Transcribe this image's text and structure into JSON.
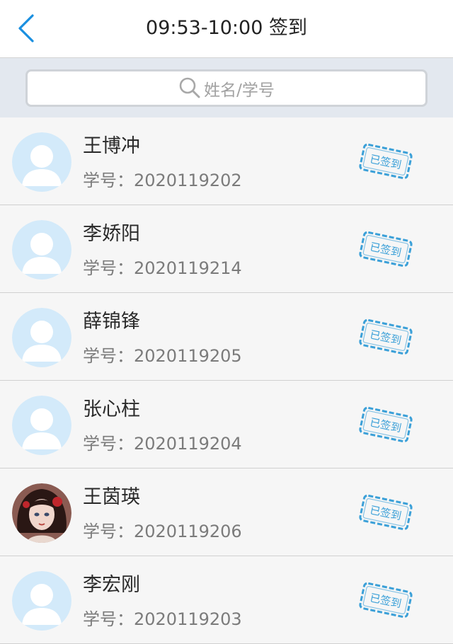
{
  "header": {
    "title": "09:53-10:00 签到"
  },
  "search": {
    "placeholder": "姓名/学号"
  },
  "students": [
    {
      "name": "王博冲",
      "id_label": "学号：2020119202",
      "status": "已签到",
      "avatar": "default"
    },
    {
      "name": "李娇阳",
      "id_label": "学号：2020119214",
      "status": "已签到",
      "avatar": "default"
    },
    {
      "name": "薛锦锋",
      "id_label": "学号：2020119205",
      "status": "已签到",
      "avatar": "default"
    },
    {
      "name": "张心柱",
      "id_label": "学号：2020119204",
      "status": "已签到",
      "avatar": "default"
    },
    {
      "name": "王茵瑛",
      "id_label": "学号：2020119206",
      "status": "已签到",
      "avatar": "photo"
    },
    {
      "name": "李宏刚",
      "id_label": "学号：2020119203",
      "status": "已签到",
      "avatar": "default"
    }
  ],
  "colors": {
    "accent": "#1a8fe0",
    "stamp": "#3ba0d8",
    "avatar_bg": "#d3eafa"
  }
}
